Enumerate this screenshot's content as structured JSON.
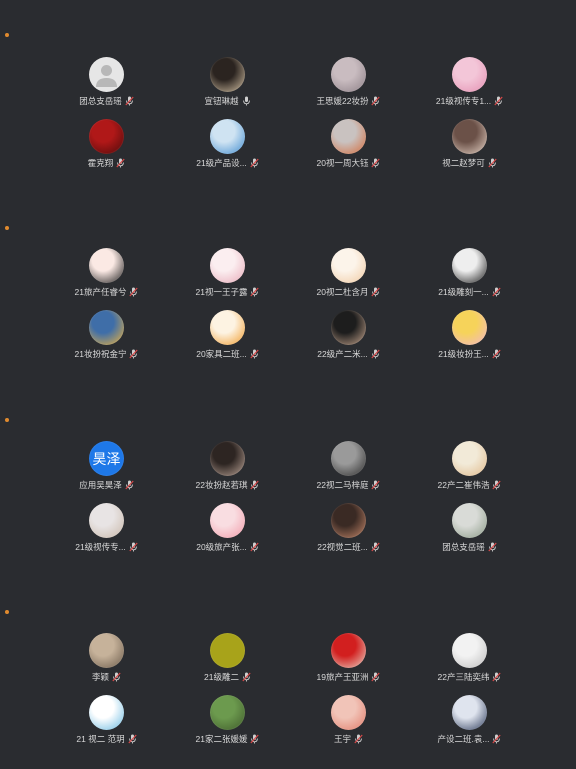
{
  "colors": {
    "background": "#2a2c30",
    "section_dot": "#e08a2e",
    "name_text": "#d9d9d9",
    "mic_muted": "#d84848",
    "mic_active": "#cfcfcf"
  },
  "sections": [
    {
      "participants": [
        {
          "name": "团总支岳瑶",
          "mic": "muted",
          "avatar": {
            "kind": "placeholder",
            "colors": [
              "#e6e6e6",
              "#b8b8b8"
            ]
          }
        },
        {
          "name": "宣钮琳越",
          "mic": "active",
          "avatar": {
            "kind": "image",
            "colors": [
              "#2b2420",
              "#d9c6a8"
            ]
          }
        },
        {
          "name": "王思媛22妆扮",
          "mic": "muted",
          "avatar": {
            "kind": "image",
            "colors": [
              "#c9bcc0",
              "#8c7f86"
            ]
          }
        },
        {
          "name": "21级视传专1...",
          "mic": "muted",
          "avatar": {
            "kind": "image",
            "colors": [
              "#f3c6d8",
              "#e48fb1"
            ]
          }
        },
        {
          "name": "霍克翔",
          "mic": "muted",
          "avatar": {
            "kind": "image",
            "colors": [
              "#b01818",
              "#4a0a0a"
            ]
          }
        },
        {
          "name": "21级产品设...",
          "mic": "muted",
          "avatar": {
            "kind": "image",
            "colors": [
              "#cfe3f2",
              "#3f8ccf"
            ]
          }
        },
        {
          "name": "20视一周大钰",
          "mic": "muted",
          "avatar": {
            "kind": "image",
            "colors": [
              "#c9c2c0",
              "#d46a3a"
            ]
          }
        },
        {
          "name": "视二赵梦可",
          "mic": "muted",
          "avatar": {
            "kind": "image",
            "colors": [
              "#6b5148",
              "#e9d6c9"
            ]
          }
        }
      ]
    },
    {
      "participants": [
        {
          "name": "21旅产任睿兮",
          "mic": "muted",
          "avatar": {
            "kind": "image",
            "colors": [
              "#fbe9e4",
              "#1a1a1a"
            ]
          }
        },
        {
          "name": "21视一王子露",
          "mic": "muted",
          "avatar": {
            "kind": "image",
            "colors": [
              "#fbeef0",
              "#e7a9b7"
            ]
          }
        },
        {
          "name": "20视二杜含月",
          "mic": "muted",
          "avatar": {
            "kind": "image",
            "colors": [
              "#fcf4ea",
              "#f0c9a1"
            ]
          }
        },
        {
          "name": "21级雕刻一...",
          "mic": "muted",
          "avatar": {
            "kind": "image",
            "colors": [
              "#eeeeee",
              "#1b1b1b"
            ]
          }
        },
        {
          "name": "21妆扮祝金宁",
          "mic": "muted",
          "avatar": {
            "kind": "image",
            "colors": [
              "#3f6ea8",
              "#f0b43a"
            ]
          }
        },
        {
          "name": "20家具二班...",
          "mic": "muted",
          "avatar": {
            "kind": "image",
            "colors": [
              "#fdf3e2",
              "#f09a2a"
            ]
          }
        },
        {
          "name": "22级产二米...",
          "mic": "muted",
          "avatar": {
            "kind": "image",
            "colors": [
              "#1d1d1d",
              "#caa890"
            ]
          }
        },
        {
          "name": "21级妆扮王...",
          "mic": "muted",
          "avatar": {
            "kind": "image",
            "colors": [
              "#f6d35a",
              "#f2b6c9"
            ]
          }
        }
      ]
    },
    {
      "participants": [
        {
          "name": "应用吴昊泽",
          "mic": "muted",
          "avatar": {
            "kind": "text",
            "text": "昊泽",
            "colors": [
              "#1e78e8",
              "#1e78e8"
            ]
          }
        },
        {
          "name": "22妆扮赵若琪",
          "mic": "muted",
          "avatar": {
            "kind": "image",
            "colors": [
              "#2d2522",
              "#bfa79a"
            ]
          }
        },
        {
          "name": "22视二马梓庭",
          "mic": "muted",
          "avatar": {
            "kind": "image",
            "colors": [
              "#9a9a9a",
              "#2b2b2b"
            ]
          }
        },
        {
          "name": "22产二崔伟浩",
          "mic": "muted",
          "avatar": {
            "kind": "image",
            "colors": [
              "#f2ead8",
              "#e0b98a"
            ]
          }
        },
        {
          "name": "21级视传专...",
          "mic": "muted",
          "avatar": {
            "kind": "image",
            "colors": [
              "#e8e4e4",
              "#c8b7a8"
            ]
          }
        },
        {
          "name": "20级旅产张...",
          "mic": "muted",
          "avatar": {
            "kind": "image",
            "colors": [
              "#f9dde1",
              "#f19aa8"
            ]
          }
        },
        {
          "name": "22视觉二班...",
          "mic": "muted",
          "avatar": {
            "kind": "image",
            "colors": [
              "#3a2a24",
              "#c98a6c"
            ]
          }
        },
        {
          "name": "团总支岳瑶",
          "mic": "muted",
          "avatar": {
            "kind": "image",
            "colors": [
              "#d9dbd7",
              "#8a9a86"
            ]
          }
        }
      ]
    },
    {
      "participants": [
        {
          "name": "李颖",
          "mic": "muted",
          "avatar": {
            "kind": "image",
            "colors": [
              "#c6b29a",
              "#6a5a4a"
            ]
          }
        },
        {
          "name": "21级雕二",
          "mic": "muted",
          "avatar": {
            "kind": "solid",
            "colors": [
              "#a8a31a",
              "#a8a31a"
            ]
          }
        },
        {
          "name": "19旅产王亚洲",
          "mic": "muted",
          "avatar": {
            "kind": "image",
            "colors": [
              "#d21f1f",
              "#e9d7c8"
            ]
          }
        },
        {
          "name": "22产三陆奕纬",
          "mic": "muted",
          "avatar": {
            "kind": "image",
            "colors": [
              "#f2f2f2",
              "#bdbdbd"
            ]
          }
        },
        {
          "name": "21 视二 范玥",
          "mic": "muted",
          "avatar": {
            "kind": "image",
            "colors": [
              "#ffffff",
              "#66b8e0"
            ]
          }
        },
        {
          "name": "21家二张媛媛",
          "mic": "muted",
          "avatar": {
            "kind": "image",
            "colors": [
              "#6c9a4e",
              "#3e5a2a"
            ]
          }
        },
        {
          "name": "王宇",
          "mic": "muted",
          "avatar": {
            "kind": "image",
            "colors": [
              "#f1c4b8",
              "#e07a68"
            ]
          }
        },
        {
          "name": "产设二班.袁...",
          "mic": "muted",
          "avatar": {
            "kind": "image",
            "colors": [
              "#dfe4ee",
              "#2c3a5a"
            ]
          }
        }
      ]
    }
  ]
}
